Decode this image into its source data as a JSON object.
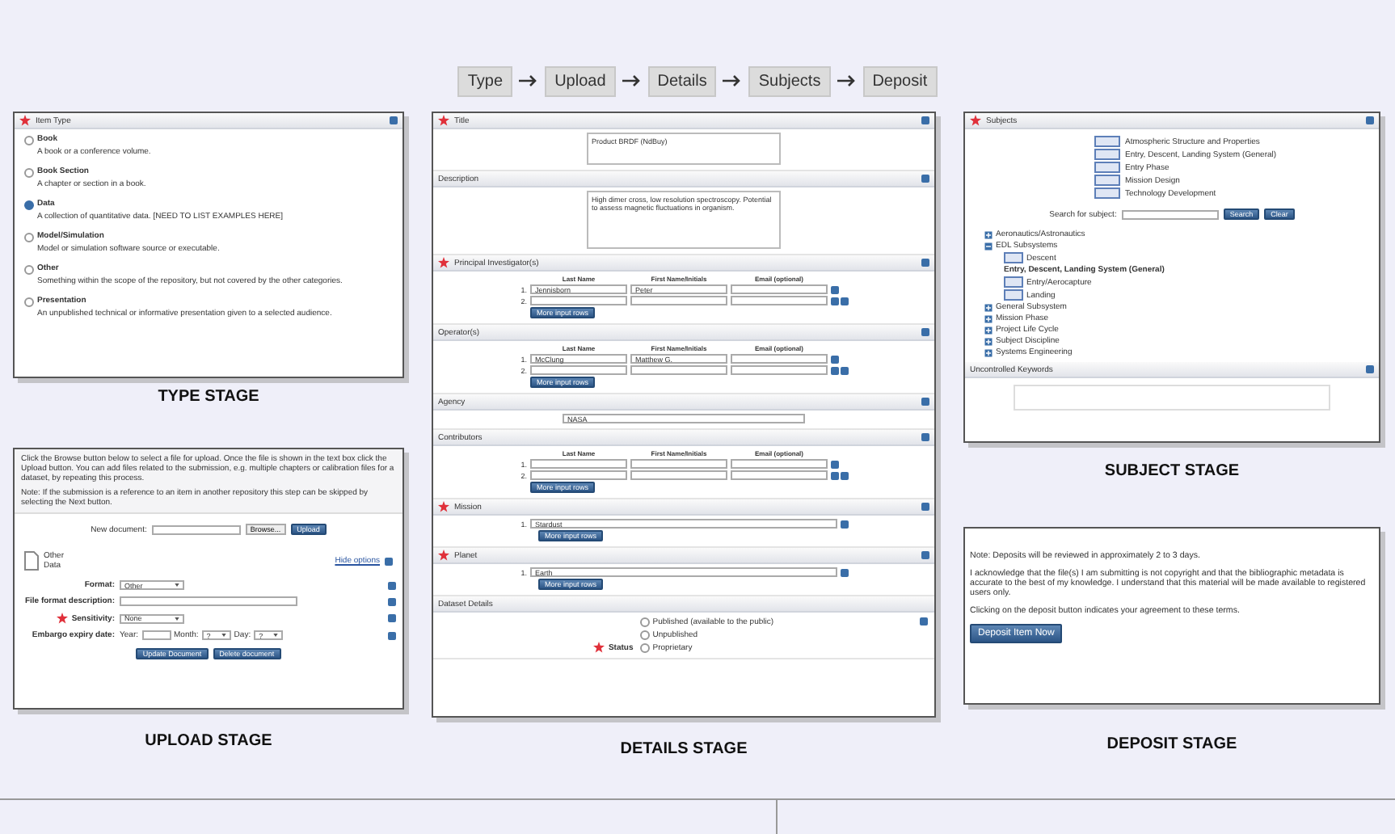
{
  "steps": [
    "Type",
    "Upload",
    "Details",
    "Subjects",
    "Deposit"
  ],
  "type_stage": {
    "title": "Item Type",
    "required": true,
    "caption": "TYPE STAGE",
    "options": [
      {
        "label": "Book",
        "description": "A book or a conference volume.",
        "selected": false
      },
      {
        "label": "Book Section",
        "description": "A chapter or section in a book.",
        "selected": false
      },
      {
        "label": "Data",
        "description": "A collection of quantitative data. [NEED TO LIST EXAMPLES HERE]",
        "selected": true
      },
      {
        "label": "Model/Simulation",
        "description": "Model or simulation software source or executable.",
        "selected": false
      },
      {
        "label": "Other",
        "description": "Something within the scope of the repository, but not covered by the other categories.",
        "selected": false
      },
      {
        "label": "Presentation",
        "description": "An unpublished technical or informative presentation given to a selected audience.",
        "selected": false
      }
    ]
  },
  "upload_stage": {
    "caption": "UPLOAD STAGE",
    "instructions": [
      "Click the Browse button below to select a file for upload. Once the file is shown in the text box click the Upload button. You can add files related to the submission, e.g. multiple chapters or calibration files for a dataset, by repeating this process.",
      "Note: If the submission is a reference to an item in another repository this step can be skipped by selecting the Next button."
    ],
    "new_document_label": "New document:",
    "browse_button": "Browse...",
    "upload_button": "Upload",
    "document": {
      "format": "Other",
      "name": "Data"
    },
    "hide_options": "Hide options",
    "fields": [
      {
        "kind": "select",
        "label": "Format:",
        "value": "Other",
        "required": false
      },
      {
        "kind": "text",
        "label": "File format description:",
        "required": false
      },
      {
        "kind": "select",
        "label": "Sensitivity:",
        "value": "None",
        "required": true
      },
      {
        "kind": "date",
        "label": "Embargo expiry date:",
        "required": false,
        "parts": [
          {
            "kind": "text",
            "label": "Year:"
          },
          {
            "kind": "select",
            "label": "Month:",
            "value": "?"
          },
          {
            "kind": "select",
            "label": "Day:",
            "value": "?"
          }
        ]
      }
    ],
    "buttons": [
      "Update Document",
      "Delete document"
    ]
  },
  "details_stage": {
    "caption": "DETAILS STAGE",
    "sections": [
      {
        "kind": "textarea",
        "title": "Title",
        "required": true,
        "value": "Product BRDF (NdBuy)"
      },
      {
        "kind": "textarea",
        "title": "Description",
        "required": false,
        "value": "High dimer cross, low resolution spectroscopy. Potential to assess magnetic fluctuations in organism."
      },
      {
        "kind": "names",
        "title": "Principal Investigator(s)",
        "required": true,
        "columns": [
          "Last Name",
          "First Name/Initials",
          "Email (optional)"
        ],
        "rows": [
          {
            "number": "1.",
            "last": "Jennisborn",
            "first": "Peter"
          },
          {
            "number": "2."
          }
        ],
        "button": "More input rows"
      },
      {
        "kind": "names",
        "title": "Operator(s)",
        "required": false,
        "columns": [
          "Last Name",
          "First Name/Initials",
          "Email (optional)"
        ],
        "rows": [
          {
            "number": "1.",
            "last": "McClung",
            "first": "Matthew G."
          },
          {
            "number": "2."
          }
        ],
        "button": "More input rows"
      },
      {
        "kind": "text",
        "title": "Agency",
        "required": false,
        "value": "NASA"
      },
      {
        "kind": "names",
        "title": "Contributors",
        "required": false,
        "columns": [
          "Last Name",
          "First Name/Initials",
          "Email (optional)"
        ],
        "rows": [
          {
            "number": "1."
          },
          {
            "number": "2."
          }
        ],
        "button": "More input rows"
      },
      {
        "kind": "list",
        "title": "Mission",
        "required": true,
        "items": [
          {
            "number": "1.",
            "value": "Stardust"
          }
        ],
        "button": "More input rows"
      },
      {
        "kind": "list",
        "title": "Planet",
        "required": true,
        "items": [
          {
            "number": "1.",
            "value": "Earth"
          }
        ],
        "button": "More input rows"
      },
      {
        "kind": "radios",
        "title": "Dataset Details",
        "required": false,
        "label": "Status",
        "label_required": true,
        "options": [
          {
            "label": "Published (available to the public)",
            "selected": false
          },
          {
            "label": "Unpublished",
            "selected": false
          },
          {
            "label": "Proprietary",
            "selected": false
          }
        ]
      }
    ]
  },
  "subjects_stage": {
    "caption": "SUBJECT STAGE",
    "title": "Subjects",
    "required": true,
    "selected": [
      "Atmospheric Structure and Properties",
      "Entry, Descent, Landing System (General)",
      "Entry Phase",
      "Mission Design",
      "Technology Development"
    ],
    "search_label": "Search for subject:",
    "search_button": "Search",
    "clear_button": "Clear",
    "tree": [
      {
        "label": "Aeronautics/Astronautics",
        "expanded": false
      },
      {
        "label": "EDL Subsystems",
        "expanded": true,
        "children": [
          {
            "label": "Descent",
            "selected": false
          },
          {
            "label": "Entry, Descent, Landing System (General)",
            "selected": true
          },
          {
            "label": "Entry/Aerocapture",
            "selected": false
          },
          {
            "label": "Landing",
            "selected": false
          }
        ]
      },
      {
        "label": "General Subsystem",
        "expanded": false
      },
      {
        "label": "Mission Phase",
        "expanded": false
      },
      {
        "label": "Project Life Cycle",
        "expanded": false
      },
      {
        "label": "Subject Discipline",
        "expanded": false
      },
      {
        "label": "Systems Engineering",
        "expanded": false
      }
    ],
    "keywords_title": "Uncontrolled Keywords"
  },
  "deposit_stage": {
    "caption": "DEPOSIT STAGE",
    "paragraphs": [
      "Note: Deposits will be reviewed in approximately 2 to 3 days.",
      "I acknowledge that the file(s) I am submitting is not copyright and that the bibliographic metadata is accurate to the best of my knowledge. I understand that this material will be made available to registered users only.",
      "Clicking on the deposit button indicates your agreement to these terms."
    ],
    "button": "Deposit Item Now"
  }
}
